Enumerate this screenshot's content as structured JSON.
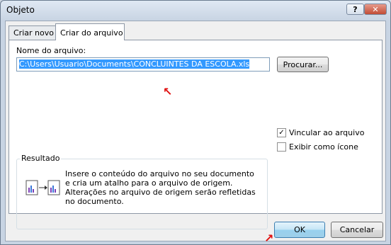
{
  "window": {
    "title": "Objeto",
    "help_label": "?",
    "close_label": "✕"
  },
  "tabs": [
    {
      "label": "Criar novo"
    },
    {
      "label": "Criar do arquivo"
    }
  ],
  "form": {
    "filename_label": "Nome do arquivo:",
    "filename_value": "C:\\Users\\Usuario\\Documents\\CONCLUINTES DA ESCOLA.xls",
    "browse_label": "Procurar..."
  },
  "options": {
    "link_label": "Vincular ao arquivo",
    "link_checked": true,
    "icon_label": "Exibir como ícone",
    "icon_checked": false
  },
  "result": {
    "title": "Resultado",
    "text": "Insere o conteúdo do arquivo no seu documento e cria um atalho para o arquivo de origem. Alterações no arquivo de origem serão refletidas no documento."
  },
  "footer": {
    "ok_label": "OK",
    "cancel_label": "Cancelar"
  },
  "colors": {
    "selection": "#3399ff",
    "annotation_arrow": "#e01010"
  }
}
